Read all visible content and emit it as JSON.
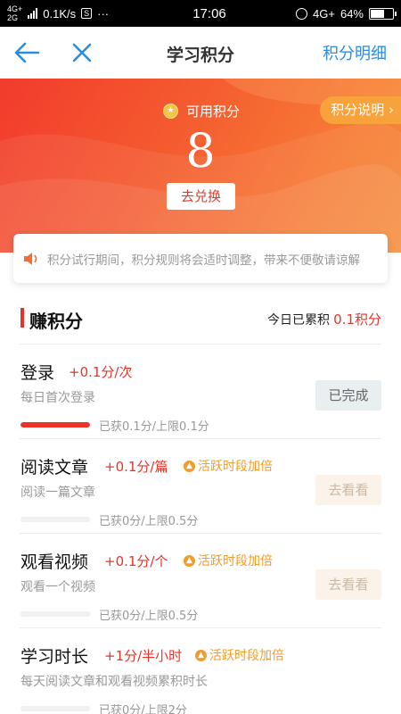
{
  "status_bar": {
    "network_top": "4G+",
    "network_bottom": "2G",
    "speed": "0.1K/s",
    "app_badge": "S",
    "more": "···",
    "time": "17:06",
    "signal_right": "4G+",
    "battery": "64%",
    "battery_level": 0.64
  },
  "nav": {
    "title": "学习积分",
    "detail_label": "积分明细"
  },
  "hero": {
    "available_label": "可用积分",
    "points": "8",
    "redeem_label": "去兑换",
    "explain_label": "积分说明 ›"
  },
  "notice": {
    "text": "积分试行期间，积分规则将会适时调整，带来不便敬请谅解"
  },
  "section": {
    "title": "赚积分",
    "today_label": "今日已累积",
    "today_value": "0.1积分"
  },
  "tasks": [
    {
      "name": "登录",
      "points": "+0.1分/次",
      "bonus": "",
      "desc": "每日首次登录",
      "progress_text": "已获0.1分/上限0.1分",
      "progress": 1.0,
      "button": "已完成"
    },
    {
      "name": "阅读文章",
      "points": "+0.1分/篇",
      "bonus": "活跃时段加倍",
      "desc": "阅读一篇文章",
      "progress_text": "已获0分/上限0.5分",
      "progress": 0,
      "button": "去看看"
    },
    {
      "name": "观看视频",
      "points": "+0.1分/个",
      "bonus": "活跃时段加倍",
      "desc": "观看一个视频",
      "progress_text": "已获0分/上限0.5分",
      "progress": 0,
      "button": "去看看"
    },
    {
      "name": "学习时长",
      "points": "+1分/半小时",
      "bonus": "活跃时段加倍",
      "desc": "每天阅读文章和观看视频累积时长",
      "progress_text": "已获0分/上限2分",
      "progress": 0,
      "button": ""
    }
  ],
  "colors": {
    "accent_red": "#e8332a",
    "link_blue": "#2b8ce0",
    "bonus_orange": "#f39c29"
  }
}
